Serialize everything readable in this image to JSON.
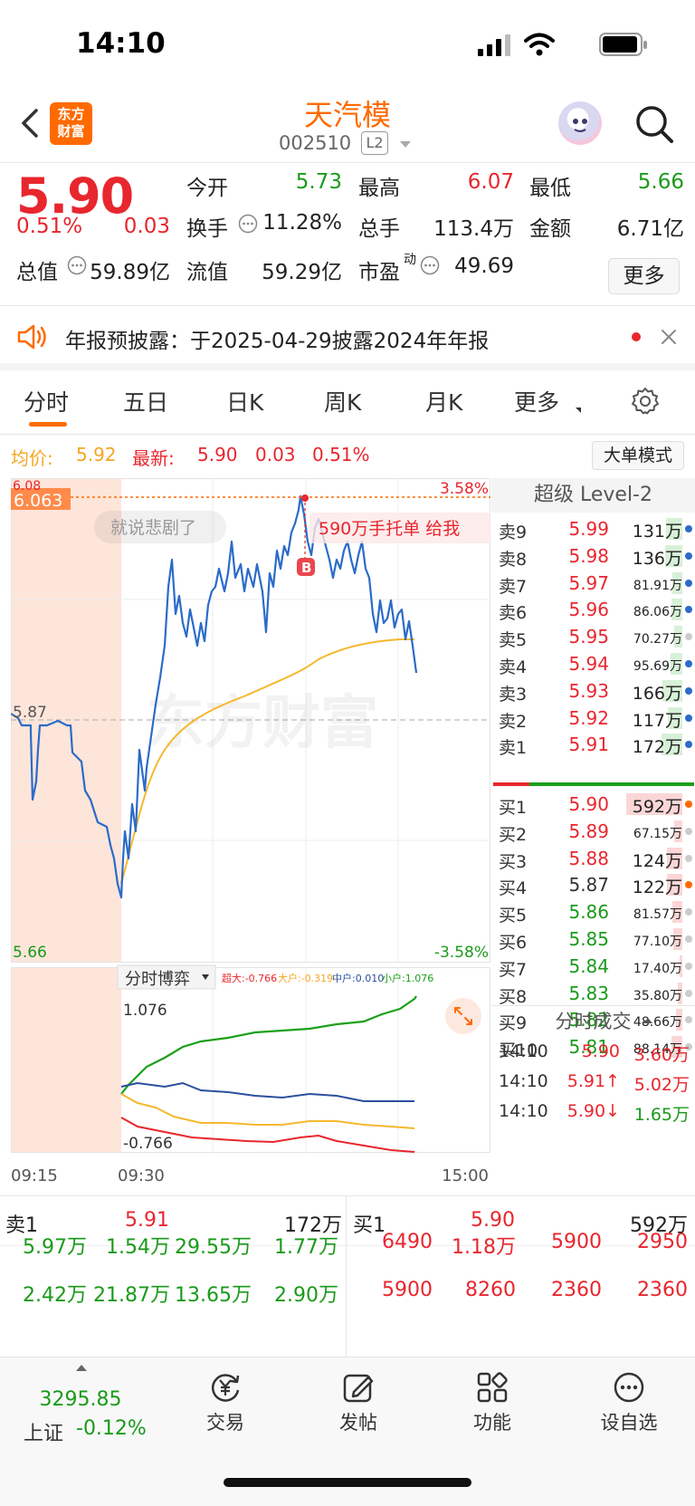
{
  "status": {
    "time": "14:10"
  },
  "header": {
    "logo_text_1": "东方",
    "logo_text_2": "财富",
    "stock_name": "天汽模",
    "stock_code": "002510",
    "level_badge": "L2"
  },
  "quote": {
    "last_price": "5.90",
    "change_pct": "0.51%",
    "change_amt": "0.03",
    "open_label": "今开",
    "open_value": "5.73",
    "high_label": "最高",
    "high_value": "6.07",
    "low_label": "最低",
    "low_value": "5.66",
    "turnover_label": "换手",
    "turnover_value": "11.28%",
    "volume_label": "总手",
    "volume_value": "113.4万",
    "amount_label": "金额",
    "amount_value": "6.71亿",
    "mktcap_label": "总值",
    "mktcap_value": "59.89亿",
    "float_label": "流值",
    "float_value": "59.29亿",
    "pe_label": "市盈",
    "pe_sup": "动",
    "pe_value": "49.69",
    "more_button": "更多"
  },
  "notice": {
    "text": "年报预披露：于2025-04-29披露2024年年报"
  },
  "tabs": [
    "分时",
    "五日",
    "日K",
    "周K",
    "月K",
    "更多"
  ],
  "info_row": {
    "avg_label": "均价:",
    "avg_value": "5.92",
    "latest_label": "最新:",
    "latest_value": "5.90",
    "latest_change": "0.03",
    "latest_pct": "0.51%",
    "big_order_button": "大单模式"
  },
  "chart": {
    "top_price_left": "6.08",
    "crosshair_price": "6.063",
    "top_pct": "3.58%",
    "mid_price": "5.87",
    "bottom_price": "5.66",
    "bottom_pct": "-3.58%",
    "comment_bubble": "就说悲剧了",
    "bubble_text": "590万手托单 给我",
    "buy_marker": "B",
    "watermark": "东方财富",
    "indicator_tab": "分时博弈",
    "legend_super": "超大:-0.766",
    "legend_large": "大户:-0.319",
    "legend_mid": "中户:0.010",
    "legend_small": "小户:1.076",
    "sub_top": "1.076",
    "sub_bottom": "-0.766",
    "time_start": "09:15",
    "time_open": "09:30",
    "time_end": "15:00",
    "colors": {
      "price": "#2b6bc9",
      "avg": "#f5b82e",
      "small": "#1aa01a",
      "mid": "#2b4f9e",
      "large": "#f5b82e",
      "super": "#e8262e"
    }
  },
  "order_book": {
    "title": "超级 Level-2",
    "asks": [
      {
        "label": "卖9",
        "price": "5.99",
        "vol": "131万"
      },
      {
        "label": "卖8",
        "price": "5.98",
        "vol": "136万"
      },
      {
        "label": "卖7",
        "price": "5.97",
        "vol": "81.91万"
      },
      {
        "label": "卖6",
        "price": "5.96",
        "vol": "86.06万"
      },
      {
        "label": "卖5",
        "price": "5.95",
        "vol": "70.27万"
      },
      {
        "label": "卖4",
        "price": "5.94",
        "vol": "95.69万"
      },
      {
        "label": "卖3",
        "price": "5.93",
        "vol": "166万"
      },
      {
        "label": "卖2",
        "price": "5.92",
        "vol": "117万"
      },
      {
        "label": "卖1",
        "price": "5.91",
        "vol": "172万"
      }
    ],
    "bids": [
      {
        "label": "买1",
        "price": "5.90",
        "vol": "592万"
      },
      {
        "label": "买2",
        "price": "5.89",
        "vol": "67.15万"
      },
      {
        "label": "买3",
        "price": "5.88",
        "vol": "124万"
      },
      {
        "label": "买4",
        "price": "5.87",
        "vol": "122万"
      },
      {
        "label": "买5",
        "price": "5.86",
        "vol": "81.57万"
      },
      {
        "label": "买6",
        "price": "5.85",
        "vol": "77.10万"
      },
      {
        "label": "买7",
        "price": "5.84",
        "vol": "17.40万"
      },
      {
        "label": "买8",
        "price": "5.83",
        "vol": "35.80万"
      },
      {
        "label": "买9",
        "price": "5.82",
        "vol": "48.66万"
      },
      {
        "label": "买10",
        "price": "5.81",
        "vol": "88.14万"
      }
    ],
    "ticks_title": "分时成交",
    "ticks": [
      {
        "time": "14:10",
        "price": "5.90",
        "vol": "3.60万"
      },
      {
        "time": "14:10",
        "price": "5.91↑",
        "vol": "5.02万"
      },
      {
        "time": "14:10",
        "price": "5.90↓",
        "vol": "1.65万"
      }
    ]
  },
  "stats": {
    "ask1_label": "卖1",
    "ask1_price": "5.91",
    "ask1_vol": "172万",
    "bid1_label": "买1",
    "bid1_price": "5.90",
    "bid1_vol": "592万",
    "ask_row1": [
      "5.97万",
      "1.54万",
      "29.55万",
      "1.77万"
    ],
    "ask_row2": [
      "2.42万",
      "21.87万",
      "13.65万",
      "2.90万"
    ],
    "bid_row1": [
      "6490",
      "1.18万",
      "5900",
      "2950"
    ],
    "bid_row2": [
      "5900",
      "8260",
      "2360",
      "2360"
    ]
  },
  "nav": {
    "index_value": "3295.85",
    "index_name": "上证",
    "index_change": "-0.12%",
    "items": [
      "交易",
      "发帖",
      "功能",
      "设自选"
    ]
  }
}
